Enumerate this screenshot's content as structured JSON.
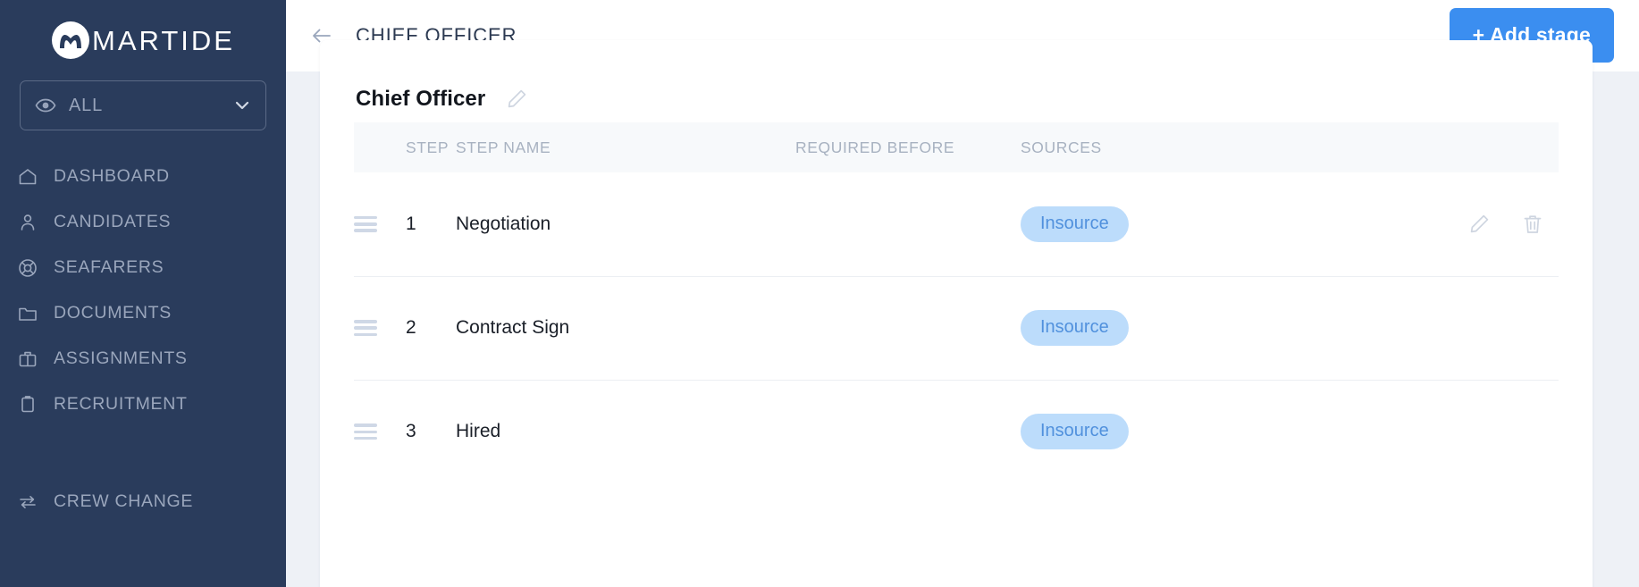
{
  "brand": {
    "name": "MARTIDE",
    "logo_icon": "martide-circle-m-logo"
  },
  "sidebar": {
    "filter": {
      "eye_icon": "eye-icon",
      "value": "ALL",
      "chevron_icon": "chevron-down-icon"
    },
    "items": [
      {
        "label": "DASHBOARD",
        "icon": "home-icon"
      },
      {
        "label": "CANDIDATES",
        "icon": "user-icon"
      },
      {
        "label": "SEAFARERS",
        "icon": "life-ring-icon"
      },
      {
        "label": "DOCUMENTS",
        "icon": "folder-icon"
      },
      {
        "label": "ASSIGNMENTS",
        "icon": "briefcase-icon"
      },
      {
        "label": "RECRUITMENT",
        "icon": "clipboard-icon"
      },
      {
        "label": "CREW CHANGE",
        "icon": "swap-arrows-icon"
      }
    ]
  },
  "topbar": {
    "back_icon": "arrow-left-icon",
    "title": "CHIEF OFFICER",
    "add_stage_label": "+ Add stage"
  },
  "card": {
    "title": "Chief Officer",
    "edit_icon": "pencil-icon",
    "table": {
      "columns": [
        "STEP",
        "STEP NAME",
        "REQUIRED BEFORE",
        "SOURCES"
      ],
      "rows": [
        {
          "handle_icon": "drag-handle-icon",
          "step": "1",
          "name": "Negotiation",
          "required_before": "",
          "source": "Insource",
          "edit_icon": "pencil-icon",
          "delete_icon": "trash-icon",
          "actions_visible": true
        },
        {
          "handle_icon": "drag-handle-icon",
          "step": "2",
          "name": "Contract Sign",
          "required_before": "",
          "source": "Insource",
          "edit_icon": "pencil-icon",
          "delete_icon": "trash-icon",
          "actions_visible": false
        },
        {
          "handle_icon": "drag-handle-icon",
          "step": "3",
          "name": "Hired",
          "required_before": "",
          "source": "Insource",
          "edit_icon": "pencil-icon",
          "delete_icon": "trash-icon",
          "actions_visible": false
        }
      ]
    }
  },
  "colors": {
    "sidebar_bg": "#2a3c5c",
    "page_bg": "#eef1f6",
    "accent_blue": "#3b8ef0",
    "pill_bg": "#bcdcfb",
    "pill_text": "#5191dd"
  }
}
